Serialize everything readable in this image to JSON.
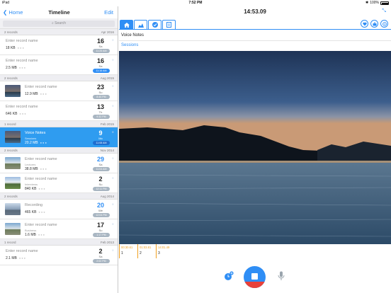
{
  "status_bar": {
    "device": "iPad",
    "time": "7:52 PM",
    "battery": "100%"
  },
  "nav": {
    "back_label": "Home",
    "title": "Timeline",
    "edit_label": "Edit"
  },
  "search": {
    "placeholder": "Search"
  },
  "sections": [
    {
      "count": "2 records",
      "date": "Apr 2016",
      "rows": [
        {
          "name": "Enter record name",
          "sub": "",
          "size": "18 KB",
          "day": "16",
          "weekday": "Sa",
          "time": "11:25 AM",
          "highlight": false,
          "thumb": ""
        },
        {
          "name": "Enter record name",
          "sub": "",
          "size": "2.5 MB",
          "day": "16",
          "weekday": "Sa",
          "time": "11:16 AM",
          "highlight": true,
          "thumb": ""
        }
      ]
    },
    {
      "count": "2 records",
      "date": "Aug 2015",
      "rows": [
        {
          "name": "Enter record name",
          "sub": "",
          "size": "12.9 MB",
          "day": "23",
          "weekday": "Su",
          "time": "8:40 PM",
          "highlight": false,
          "thumb": "img-ph1"
        },
        {
          "name": "Enter record name",
          "sub": "",
          "size": "646 KB",
          "day": "13",
          "weekday": "Th",
          "time": "9:32 PM",
          "highlight": false,
          "thumb": ""
        }
      ]
    },
    {
      "count": "1 record",
      "date": "Feb 2015",
      "rows": [
        {
          "name": "Voice Notes",
          "sub": "Sessions",
          "size": "20.2 MB",
          "day": "9",
          "weekday": "Mo",
          "time": "11:08 AM",
          "highlight": false,
          "thumb": "img-ph1",
          "selected": true
        }
      ]
    },
    {
      "count": "2 records",
      "date": "Nov 2014",
      "rows": [
        {
          "name": "Enter record name",
          "sub": "Lectures",
          "size": "38.8 MB",
          "day": "29",
          "weekday": "Sa",
          "time": "11:04 AM",
          "highlight": false,
          "thumb": "img-ph2"
        },
        {
          "name": "Enter record name",
          "sub": "Interviews",
          "size": "840 KB",
          "day": "2",
          "weekday": "Su",
          "time": "12:11 PM",
          "highlight": false,
          "thumb": "img-ph3"
        }
      ]
    },
    {
      "count": "2 records",
      "date": "Aug 2014",
      "rows": [
        {
          "name": "Recording",
          "sub": "",
          "size": "465 KB",
          "day": "20",
          "weekday": "We",
          "time": "12:04 PM",
          "highlight": false,
          "thumb": "img-ph4"
        },
        {
          "name": "Enter record name",
          "sub": "Business",
          "size": "1.6 MB",
          "day": "17",
          "weekday": "Su",
          "time": "1:17 PM",
          "highlight": false,
          "thumb": "img-ph2"
        }
      ]
    },
    {
      "count": "1 record",
      "date": "Feb 2013",
      "rows": [
        {
          "name": "Enter record name",
          "sub": "",
          "size": "2.1 MB",
          "day": "2",
          "weekday": "Sa",
          "time": "2:02 PM",
          "highlight": false,
          "thumb": ""
        }
      ]
    }
  ],
  "detail": {
    "timer": "14:53.09",
    "title": "Voice Notes",
    "category": "Sessions",
    "markers": [
      {
        "time": "00:30.61",
        "number": "1"
      },
      {
        "time": "01:03.81",
        "number": "2"
      },
      {
        "time": "14:01.49",
        "number": "3"
      }
    ]
  },
  "colors": {
    "accent": "#2f8ef5",
    "record_red": "#e8413a",
    "marker": "#f0a020"
  },
  "icons": {
    "tabs": [
      "home-icon",
      "chart-icon",
      "check-icon",
      "document-icon"
    ],
    "actions": [
      "heart-icon",
      "share-icon",
      "settings-icon"
    ]
  }
}
